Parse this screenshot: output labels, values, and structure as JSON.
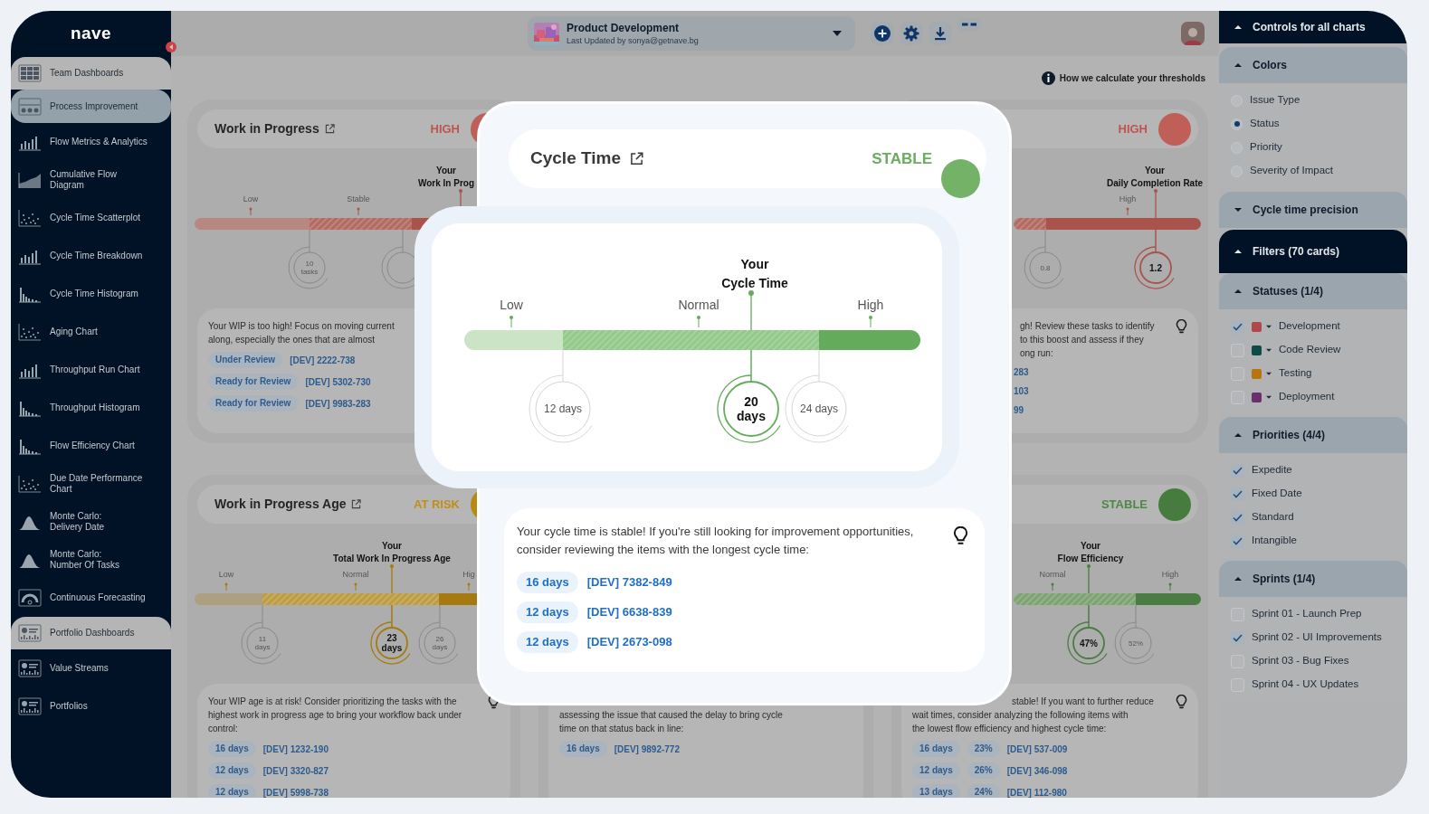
{
  "sidebar": {
    "logo": "nave",
    "items": [
      {
        "kind": "section",
        "label": "Team Dashboards",
        "selected": false
      },
      {
        "kind": "item",
        "label": "Process Improvement",
        "selected": true
      },
      {
        "kind": "item",
        "label": "Flow Metrics & Analytics",
        "selected": false
      },
      {
        "kind": "item",
        "label": "Cumulative Flow\nDiagram",
        "selected": false
      },
      {
        "kind": "item",
        "label": "Cycle Time Scatterplot",
        "selected": false
      },
      {
        "kind": "item",
        "label": "Cycle Time Breakdown",
        "selected": false
      },
      {
        "kind": "item",
        "label": "Cycle Time Histogram",
        "selected": false
      },
      {
        "kind": "item",
        "label": "Aging Chart",
        "selected": false
      },
      {
        "kind": "item",
        "label": "Throughput Run Chart",
        "selected": false
      },
      {
        "kind": "item",
        "label": "Throughput Histogram",
        "selected": false
      },
      {
        "kind": "item",
        "label": "Flow Efficiency Chart",
        "selected": false
      },
      {
        "kind": "item",
        "label": "Due Date Performance\nChart",
        "selected": false
      },
      {
        "kind": "item",
        "label": "Monte Carlo:\nDelivery Date",
        "selected": false
      },
      {
        "kind": "item",
        "label": "Monte Carlo:\nNumber Of Tasks",
        "selected": false
      },
      {
        "kind": "item",
        "label": "Continuous Forecasting",
        "selected": false
      },
      {
        "kind": "section",
        "label": "Portfolio Dashboards",
        "selected": false
      },
      {
        "kind": "item",
        "label": "Value Streams",
        "selected": false
      },
      {
        "kind": "item",
        "label": "Portfolios",
        "selected": false
      }
    ]
  },
  "top_bar": {
    "dashboard": {
      "title": "Product Development",
      "subtitle": "Last Updated by sonya@getnave.bg"
    }
  },
  "threshold_link": "How we calculate your thresholds",
  "cards": [
    {
      "kind": "high",
      "title": "Work in Progress",
      "status": "HIGH",
      "your_label": "Your\nWork In Prog",
      "scale": [
        "Low",
        "Stable"
      ],
      "markers": [
        {
          "value": "10 tasks",
          "current": false
        }
      ],
      "advice": "Your WIP is too high! Focus on moving current\nalong, especially the ones that are almost",
      "items": [
        {
          "badges": [
            "Under Review"
          ],
          "link": "[DEV] 2222-738"
        },
        {
          "badges": [
            "Ready for Review"
          ],
          "link": "[DEV] 5302-730"
        },
        {
          "badges": [
            "Ready for Review"
          ],
          "link": "[DEV] 9983-283"
        }
      ]
    },
    {
      "kind": "high",
      "status": "HIGH",
      "your_label": "Your\nDaily Completion Rate",
      "scale": [
        "High"
      ],
      "markers": [
        {
          "value": "0.8",
          "current": false
        },
        {
          "value": "1.2",
          "current": true
        }
      ],
      "advice": "gh! Review these tasks to identify\nto this boost and assess if they\nong run:",
      "items": [
        {
          "link": "283"
        },
        {
          "link": "103"
        },
        {
          "link": "99"
        }
      ]
    },
    {
      "kind": "at_risk",
      "title": "Work in Progress Age",
      "status": "AT RISK",
      "your_label": "Your\nTotal Work In Progress Age",
      "scale": [
        "Low",
        "Normal",
        "Hig"
      ],
      "markers": [
        {
          "value": "11 days",
          "current": false
        },
        {
          "value": "23 days",
          "current": true
        },
        {
          "value": "26 days",
          "current": false
        }
      ],
      "advice": "Your WIP age is at risk! Consider prioritizing the tasks with the highest work in progress age to bring your workflow back under control:",
      "items": [
        {
          "badges": [
            "16 days"
          ],
          "link": "[DEV] 1232-190"
        },
        {
          "badges": [
            "12 days"
          ],
          "link": "[DEV] 3320-827"
        },
        {
          "badges": [
            "12 days"
          ],
          "link": "[DEV] 5998-738"
        }
      ]
    },
    {
      "advice": "assessing the issue that caused the delay to bring cycle\ntime on that status back in line:",
      "items": [
        {
          "badges": [
            "16 days"
          ],
          "link": "[DEV] 9892-772"
        }
      ]
    },
    {
      "kind": "stable",
      "status": "STABLE",
      "your_label": "Your\nFlow Efficiency",
      "scale": [
        "Normal",
        "High"
      ],
      "markers": [
        {
          "value": "47%",
          "current": true
        },
        {
          "value": "52%",
          "current": false
        }
      ],
      "advice": "stable! If you want to further reduce\nwait times, consider analyzing the following items with\nthe lowest flow efficiency and highest cycle time:",
      "items": [
        {
          "badges": [
            "16 days",
            "23%"
          ],
          "link": "[DEV] 537-009"
        },
        {
          "badges": [
            "12 days",
            "26%"
          ],
          "link": "[DEV] 346-098"
        },
        {
          "badges": [
            "13 days",
            "24%"
          ],
          "link": "[DEV] 112-980"
        }
      ]
    }
  ],
  "modal": {
    "kind": "stable",
    "title": "Cycle Time",
    "status": "STABLE",
    "your_label": "Your\nCycle Time",
    "scale": [
      "Low",
      "Normal",
      "High"
    ],
    "markers": [
      {
        "value": "12 days",
        "current": false
      },
      {
        "value": "20 days",
        "current": true
      },
      {
        "value": "24 days",
        "current": false
      }
    ],
    "advice": "Your cycle time is stable! If you're still looking for improvement opportunities, consider reviewing the items with the longest cycle time:",
    "items": [
      {
        "badges": [
          "16 days"
        ],
        "link": "[DEV] 7382-849"
      },
      {
        "badges": [
          "12 days"
        ],
        "link": "[DEV] 6638-839"
      },
      {
        "badges": [
          "12 days"
        ],
        "link": "[DEV] 2673-098"
      }
    ]
  },
  "controls": {
    "title": "Controls for all charts",
    "expanded": true,
    "sections": [
      {
        "kind": "radio",
        "title": "Colors",
        "expanded": true,
        "options": [
          {
            "label": "Issue Type",
            "selected": false
          },
          {
            "label": "Status",
            "selected": true
          },
          {
            "label": "Priority",
            "selected": false
          },
          {
            "label": "Severity of Impact",
            "selected": false
          }
        ]
      },
      {
        "kind": "group",
        "title": "Cycle time precision",
        "expanded": false
      }
    ]
  },
  "filters": {
    "title": "Filters (70 cards)",
    "expanded": true,
    "sections": [
      {
        "kind": "checkbox",
        "title": "Statuses (1/4)",
        "expanded": true,
        "options": [
          {
            "label": "Development",
            "checked": true,
            "color": "#b0474a"
          },
          {
            "label": "Code Review",
            "checked": false,
            "color": "#0e4b47"
          },
          {
            "label": "Testing",
            "checked": false,
            "color": "#b8740f"
          },
          {
            "label": "Deployment",
            "checked": false,
            "color": "#6b2e6e"
          }
        ]
      },
      {
        "kind": "checkbox",
        "title": "Priorities (4/4)",
        "expanded": true,
        "options": [
          {
            "label": "Expedite",
            "checked": true
          },
          {
            "label": "Fixed Date",
            "checked": true
          },
          {
            "label": "Standard",
            "checked": true
          },
          {
            "label": "Intangible",
            "checked": true
          }
        ]
      },
      {
        "kind": "checkbox",
        "title": "Sprints (1/4)",
        "expanded": true,
        "options": [
          {
            "label": "Sprint 01 - Launch Prep",
            "checked": false
          },
          {
            "label": "Sprint 02 - UI Improvements",
            "checked": true
          },
          {
            "label": "Sprint 03 - Bug Fixes",
            "checked": false
          },
          {
            "label": "Sprint 04 - UX Updates",
            "checked": false
          }
        ]
      }
    ]
  }
}
